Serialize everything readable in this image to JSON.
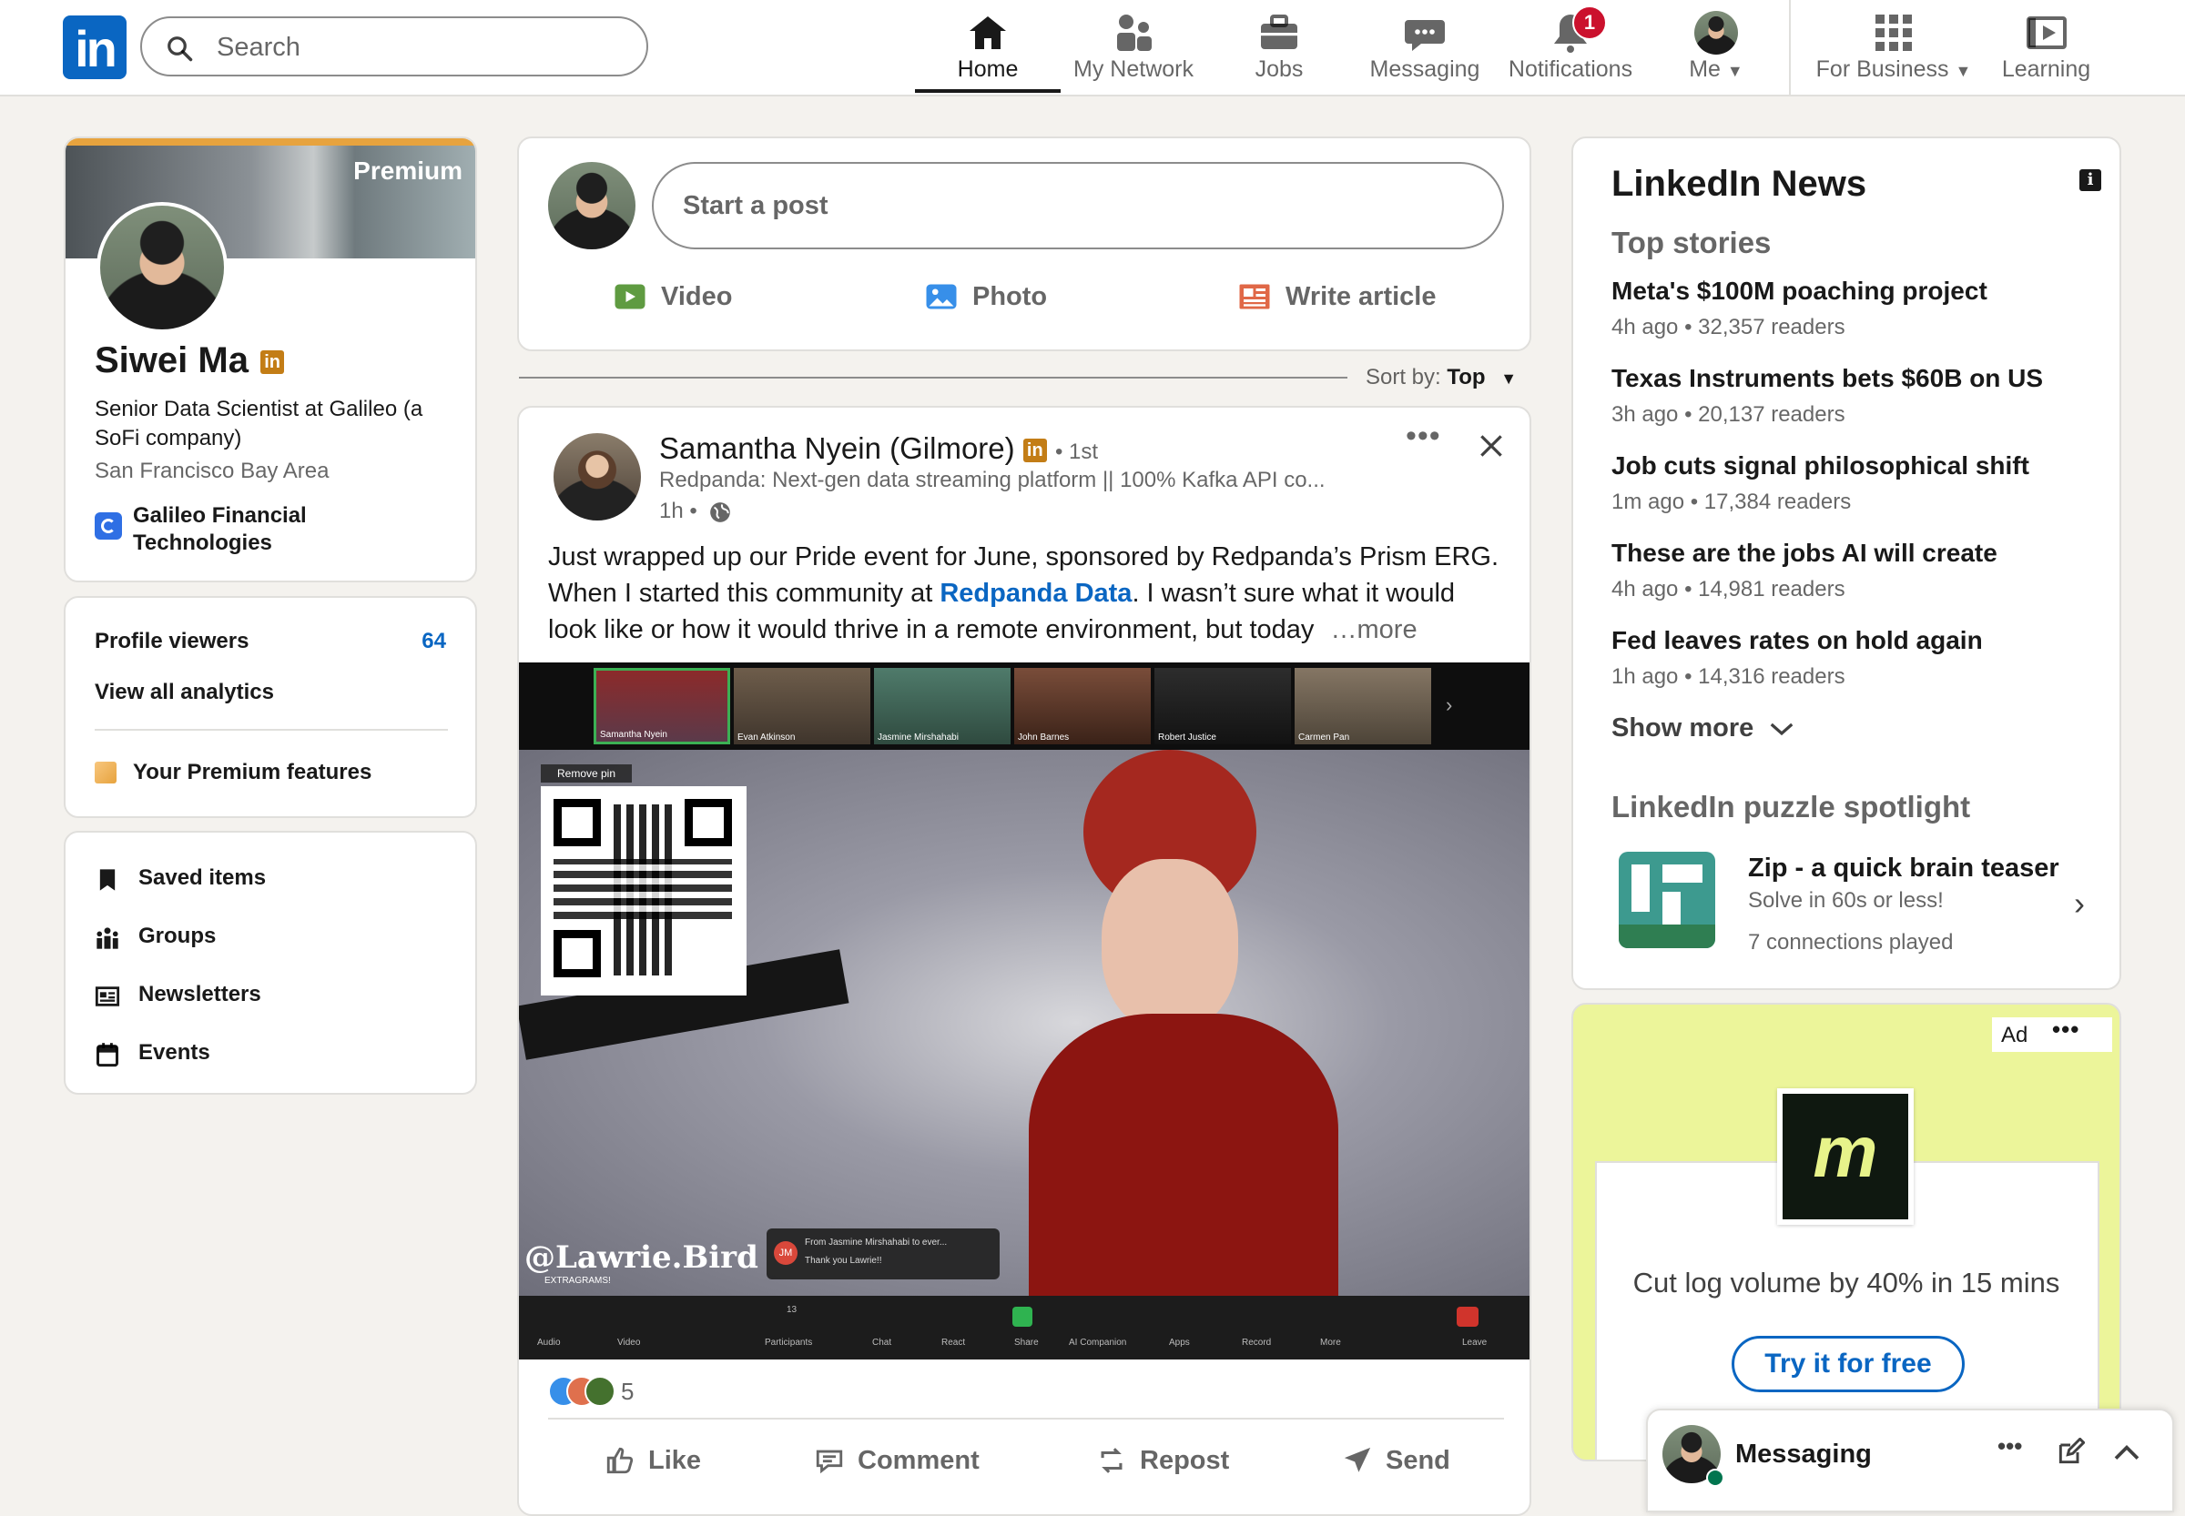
{
  "nav": {
    "search_placeholder": "Search",
    "items": [
      {
        "label": "Home"
      },
      {
        "label": "My Network"
      },
      {
        "label": "Jobs"
      },
      {
        "label": "Messaging"
      },
      {
        "label": "Notifications"
      },
      {
        "label": "Me"
      },
      {
        "label": "For Business"
      },
      {
        "label": "Learning"
      }
    ],
    "notification_count": "1"
  },
  "profile": {
    "premium_label": "Premium",
    "name": "Siwei Ma",
    "li_badge": "in",
    "headline_line1": "Senior Data Scientist at Galileo (a",
    "headline_line2": "SoFi company)",
    "location": "San Francisco Bay Area",
    "company_line1": "Galileo Financial",
    "company_line2": "Technologies"
  },
  "analytics": {
    "profile_viewers_label": "Profile viewers",
    "profile_viewers_count": "64",
    "view_all": "View all analytics",
    "premium_features": "Your Premium features"
  },
  "shortcuts": [
    {
      "label": "Saved items"
    },
    {
      "label": "Groups"
    },
    {
      "label": "Newsletters"
    },
    {
      "label": "Events"
    }
  ],
  "composer": {
    "placeholder": "Start a post",
    "video": "Video",
    "photo": "Photo",
    "article": "Write article"
  },
  "sort": {
    "label": "Sort by:",
    "value": "Top"
  },
  "post": {
    "author": "Samantha Nyein (Gilmore)",
    "li_badge": "in",
    "degree": "• 1st",
    "subtitle": "Redpanda: Next-gen data streaming platform || 100% Kafka API co...",
    "time": "1h •",
    "text_line1": "Just wrapped up our Pride event for June, sponsored by Redpanda’s Prism ERG.",
    "text_line2_pre": "When I started this community at ",
    "text_line2_link": "Redpanda Data",
    "text_line2_post": ". I wasn’t sure what it would",
    "text_line3": "look like or how it would thrive in a remote environment, but today",
    "more": "…more",
    "reactions_count": "5",
    "actions": {
      "like": "Like",
      "comment": "Comment",
      "repost": "Repost",
      "send": "Send"
    },
    "image": {
      "participants": [
        "Samantha Nyein",
        "Evan Atkinson",
        "Jasmine Mirshahabi",
        "John Barnes",
        "Robert Justice",
        "Carmen Pan"
      ],
      "remove_pin": "Remove pin",
      "handle": "@Lawrie.Bird",
      "handle_sub": "EXTRAGRAMS!",
      "chat_initials": "JM",
      "chat_from": "From Jasmine Mirshahabi to ever...",
      "chat_msg": "Thank you Lawrie!!",
      "toolbar": [
        "Audio",
        "Video",
        "Participants",
        "Chat",
        "React",
        "Share",
        "AI Companion",
        "Apps",
        "Record",
        "More",
        "Leave"
      ],
      "participants_count": "13"
    }
  },
  "news": {
    "title": "LinkedIn News",
    "subtitle": "Top stories",
    "stories": [
      {
        "headline": "Meta's $100M poaching project",
        "meta": "4h ago • 32,357 readers"
      },
      {
        "headline": "Texas Instruments bets $60B on US",
        "meta": "3h ago • 20,137 readers"
      },
      {
        "headline": "Job cuts signal philosophical shift",
        "meta": "1m ago • 17,384 readers"
      },
      {
        "headline": "These are the jobs AI will create",
        "meta": "4h ago • 14,981 readers"
      },
      {
        "headline": "Fed leaves rates on hold again",
        "meta": "1h ago • 14,316 readers"
      }
    ],
    "show_more": "Show more",
    "puzzle_title": "LinkedIn puzzle spotlight",
    "puzzle_name": "Zip - a quick brain teaser",
    "puzzle_desc": "Solve in 60s or less!",
    "puzzle_social": "7 connections played"
  },
  "ad": {
    "label": "Ad",
    "logo_letter": "m",
    "text": "Cut log volume by 40% in 15 mins",
    "cta": "Try it for free"
  },
  "messaging": {
    "label": "Messaging"
  },
  "colors": {
    "brand": "#0a66c2",
    "premium": "#c37d16",
    "ad_bg": "#ecf59a"
  }
}
